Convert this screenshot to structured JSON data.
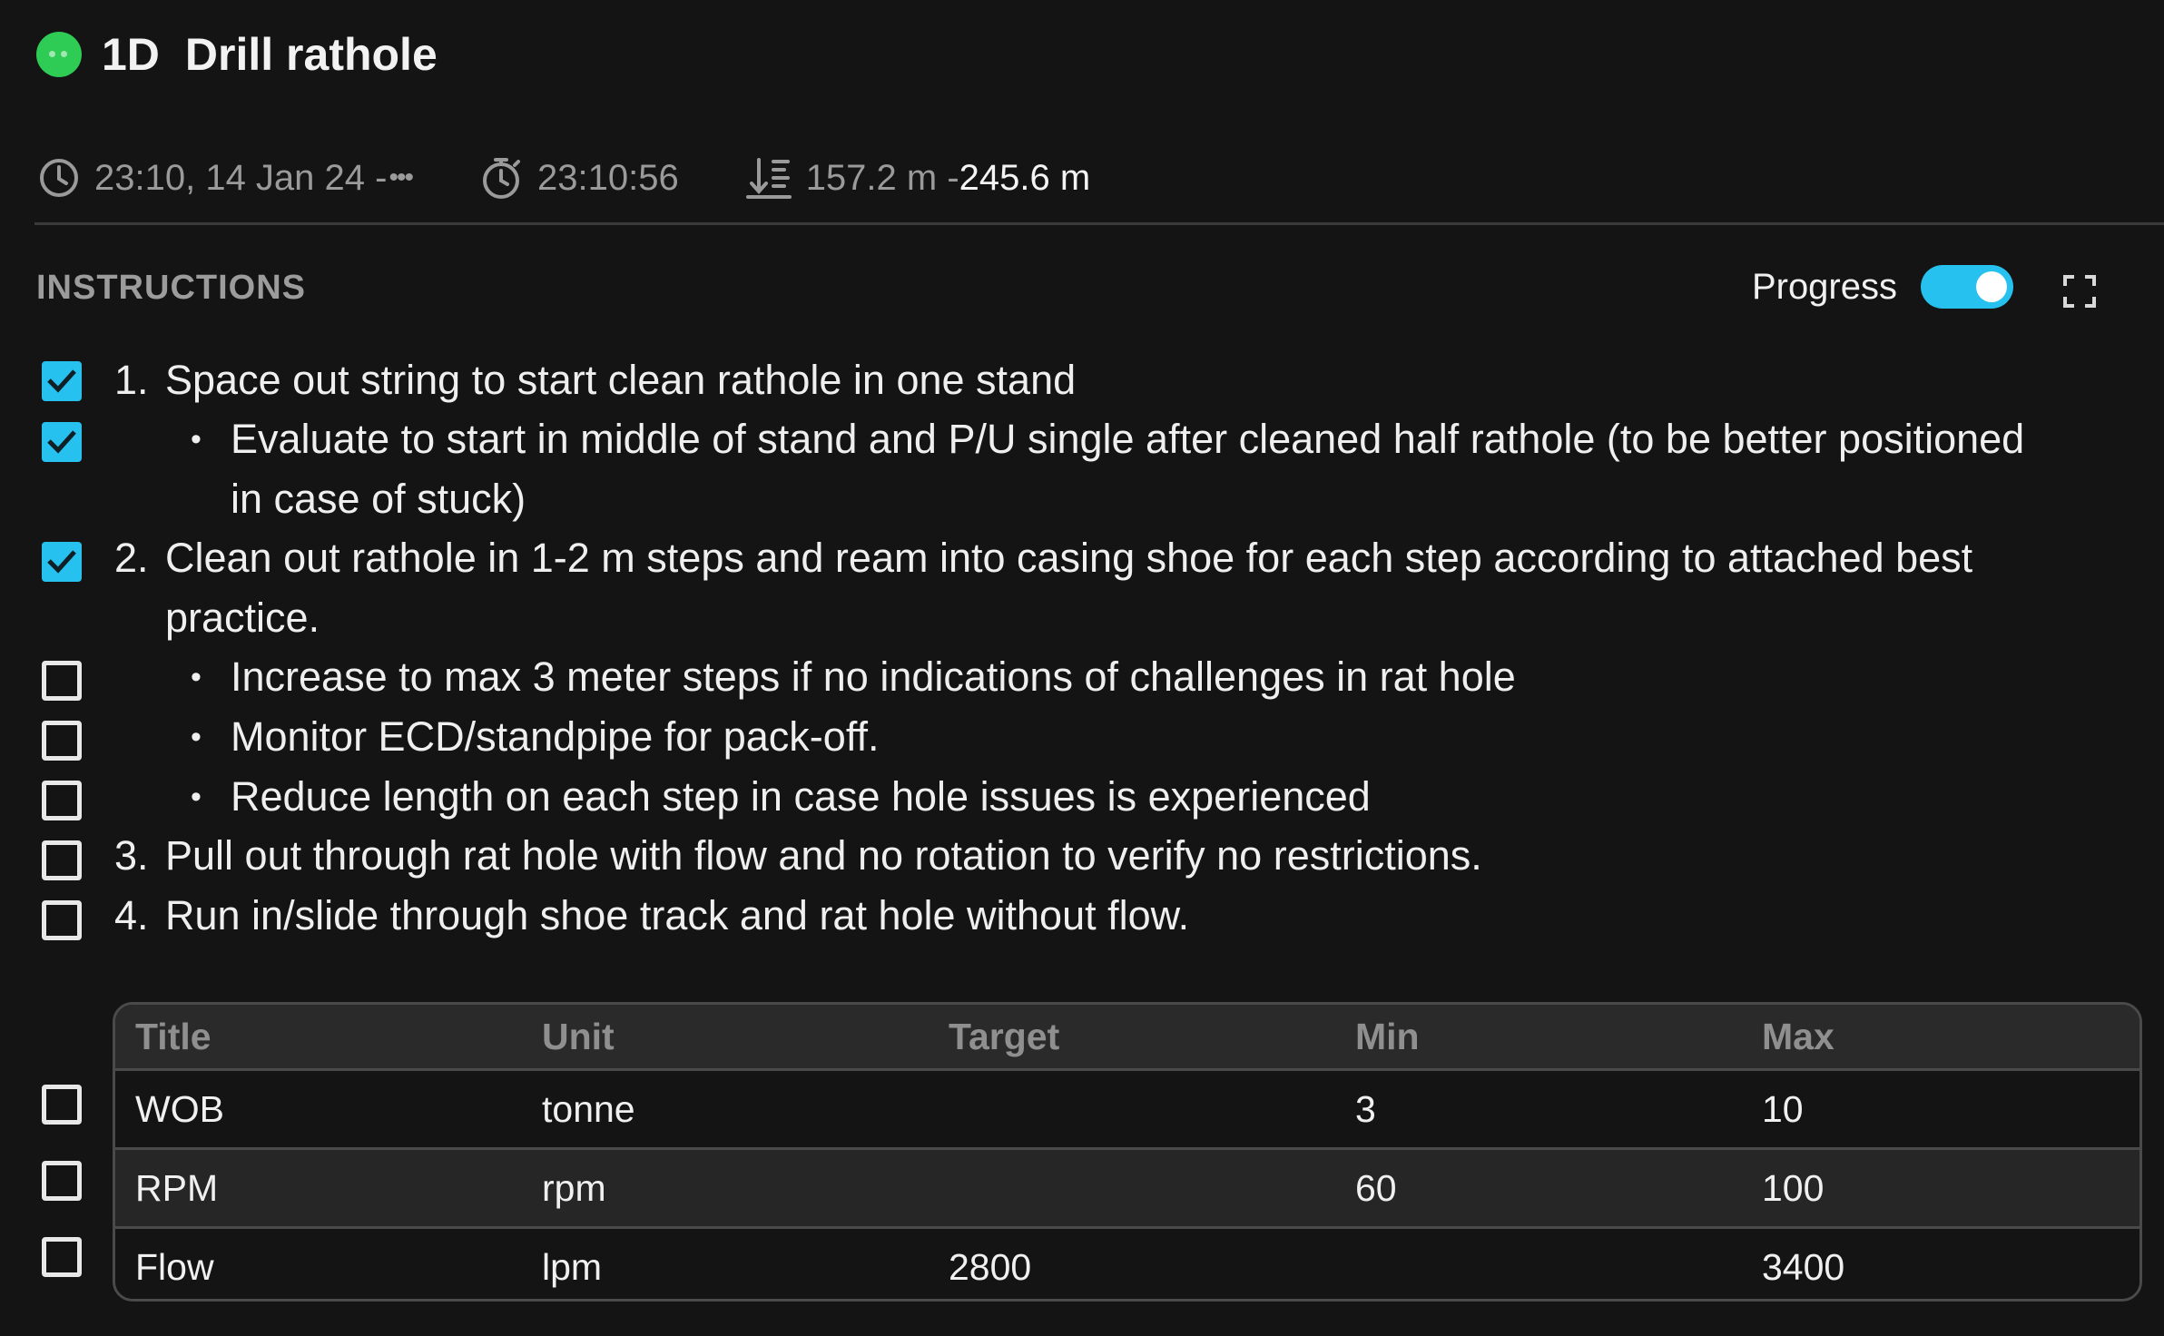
{
  "header": {
    "step_id": "1D",
    "title": "Drill rathole",
    "status_color": "#2ecc55"
  },
  "meta": {
    "start_time": "23:10, 14 Jan 24 - ",
    "end_placeholder": "•••",
    "duration": "23:10:56",
    "depth_from": "157.2 m - ",
    "depth_to": "245.6 m"
  },
  "instructions": {
    "heading": "INSTRUCTIONS",
    "progress_label": "Progress",
    "progress_enabled": true,
    "accent_color": "#27c1ef",
    "items": [
      {
        "number": "1.",
        "text": "Space out string to start clean rathole in one stand",
        "checked": true,
        "bullet": false
      },
      {
        "number": "",
        "text": "Evaluate to start in middle of stand and P/U single after cleaned half rathole (to be better positioned in case of stuck)",
        "checked": true,
        "bullet": true
      },
      {
        "number": "2.",
        "text": "Clean out rathole in 1-2 m steps and ream into casing shoe for each step according to attached best practice.",
        "checked": true,
        "bullet": false
      },
      {
        "number": "",
        "text": "Increase to max 3 meter steps if no indications of challenges in rat hole",
        "checked": false,
        "bullet": true
      },
      {
        "number": "",
        "text": "Monitor ECD/standpipe for pack-off.",
        "checked": false,
        "bullet": true
      },
      {
        "number": "",
        "text": "Reduce length on each step in case hole issues is experienced",
        "checked": false,
        "bullet": true
      },
      {
        "number": "3.",
        "text": "Pull out through rat hole with flow and no rotation to verify no restrictions.",
        "checked": false,
        "bullet": false
      },
      {
        "number": "4.",
        "text": "Run in/slide through shoe track and rat hole without flow.",
        "checked": false,
        "bullet": false
      }
    ]
  },
  "parameters": {
    "columns": [
      "Title",
      "Unit",
      "Target",
      "Min",
      "Max"
    ],
    "rows": [
      {
        "title": "WOB",
        "unit": "tonne",
        "target": "",
        "min": "3",
        "max": "10",
        "checked": false
      },
      {
        "title": "RPM",
        "unit": "rpm",
        "target": "",
        "min": "60",
        "max": "100",
        "checked": false
      },
      {
        "title": "Flow",
        "unit": "lpm",
        "target": "2800",
        "min": "",
        "max": "3400",
        "checked": false
      }
    ]
  },
  "icons": {
    "status": "status-dot-icon",
    "start": "clock-icon",
    "duration": "stopwatch-icon",
    "depth": "depth-icon",
    "expand": "fullscreen-icon",
    "check": "checkmark-icon"
  }
}
